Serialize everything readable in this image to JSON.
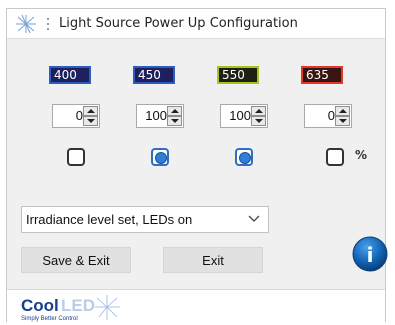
{
  "window": {
    "title": "Light Source Power Up Configuration",
    "app_icon": "coolled-starburst-icon"
  },
  "channels": [
    {
      "wavelength": "400",
      "power": "0",
      "checked": false,
      "accent": "#2c5cbf"
    },
    {
      "wavelength": "450",
      "power": "100",
      "checked": true,
      "accent": "#2c5cbf"
    },
    {
      "wavelength": "550",
      "power": "100",
      "checked": true,
      "accent": "#a7c41a"
    },
    {
      "wavelength": "635",
      "power": "0",
      "checked": false,
      "accent": "#e0392b"
    }
  ],
  "percent_symbol": "%",
  "mode_select": {
    "selected": "Irradiance level set, LEDs on"
  },
  "buttons": {
    "save_exit": "Save & Exit",
    "exit": "Exit"
  },
  "info_button": {
    "label": "i",
    "color": "#1266b6"
  },
  "logo": {
    "wordmark_dark": "Cool",
    "wordmark_light": "LED",
    "tagline": "Simply Better Control"
  }
}
